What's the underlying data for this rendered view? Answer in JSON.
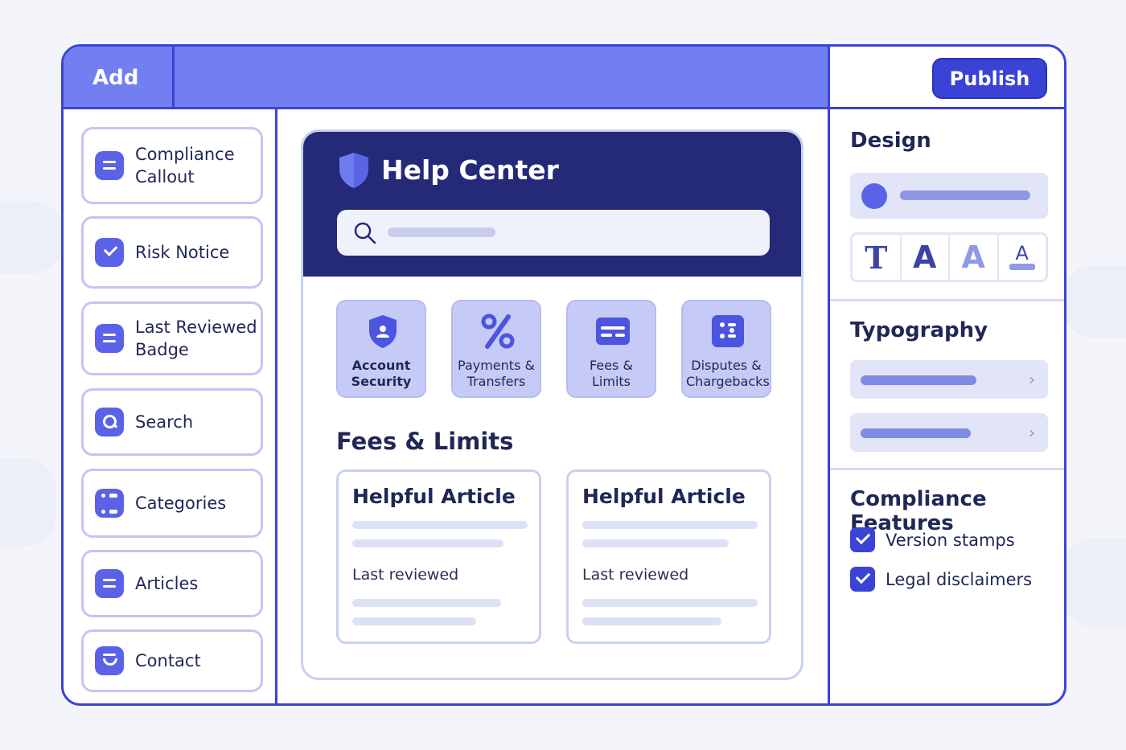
{
  "topbar": {
    "add_label": "Add",
    "publish_label": "Publish"
  },
  "sidebar": {
    "items": [
      {
        "label": "Compliance Callout",
        "icon": "lines-icon"
      },
      {
        "label": "Risk Notice",
        "icon": "check-icon"
      },
      {
        "label": "Last Reviewed Badge",
        "icon": "lines-icon"
      },
      {
        "label": "Search",
        "icon": "search-icon"
      },
      {
        "label": "Categories",
        "icon": "grid-icon"
      },
      {
        "label": "Articles",
        "icon": "lines-icon"
      },
      {
        "label": "Contact",
        "icon": "smile-icon"
      }
    ]
  },
  "help_center": {
    "title": "Help Center",
    "categories": [
      {
        "label": "Account Security",
        "icon": "shield-user-icon"
      },
      {
        "label": "Payments & Transfers",
        "icon": "percent-icon"
      },
      {
        "label": "Fees & Limits",
        "icon": "card-icon"
      },
      {
        "label": "Disputes & Chargebacks",
        "icon": "list-icon"
      }
    ],
    "section_title": "Fees & Limits",
    "articles": [
      {
        "title": "Helpful Article",
        "reviewed_label": "Last reviewed"
      },
      {
        "title": "Helpful Article",
        "reviewed_label": "Last reviewed"
      }
    ]
  },
  "right_panel": {
    "design_title": "Design",
    "typography_title": "Typography",
    "font_options": [
      "T",
      "A",
      "A",
      "A"
    ],
    "compliance_title": "Compliance Features",
    "features": [
      {
        "label": "Version stamps",
        "checked": true
      },
      {
        "label": "Legal disclaimers",
        "checked": true
      }
    ]
  },
  "colors": {
    "accent": "#3b43d6",
    "topbar": "#717ff0",
    "header_navy": "#242a78",
    "tile_bg": "#c6caf6"
  }
}
